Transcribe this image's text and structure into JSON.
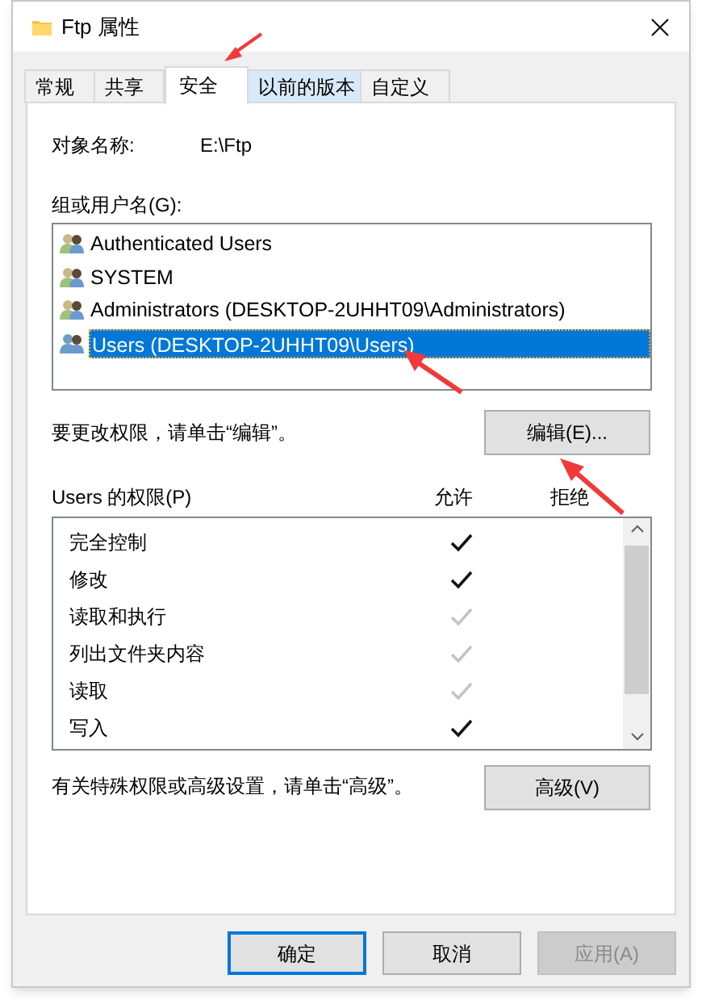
{
  "window": {
    "title": "Ftp 属性"
  },
  "tabs": [
    {
      "label": "常规",
      "selected": false,
      "highlighted": false
    },
    {
      "label": "共享",
      "selected": false,
      "highlighted": false
    },
    {
      "label": "安全",
      "selected": true,
      "highlighted": false
    },
    {
      "label": "以前的版本",
      "selected": false,
      "highlighted": true
    },
    {
      "label": "自定义",
      "selected": false,
      "highlighted": false
    }
  ],
  "object_name": {
    "label": "对象名称:",
    "value": "E:\\Ftp"
  },
  "groups": {
    "label": "组或用户名(G):",
    "items": [
      {
        "name": "Authenticated Users",
        "selected": false
      },
      {
        "name": "SYSTEM",
        "selected": false
      },
      {
        "name": "Administrators (DESKTOP-2UHHT09\\Administrators)",
        "selected": false
      },
      {
        "name": "Users (DESKTOP-2UHHT09\\Users)",
        "selected": true
      }
    ]
  },
  "edit_hint": "要更改权限，请单击“编辑”。",
  "edit_button": "编辑(E)...",
  "permissions": {
    "label": "Users 的权限(P)",
    "allow_heading": "允许",
    "deny_heading": "拒绝",
    "rows": [
      {
        "name": "完全控制",
        "allow": true,
        "inherited": false,
        "deny": false
      },
      {
        "name": "修改",
        "allow": true,
        "inherited": false,
        "deny": false
      },
      {
        "name": "读取和执行",
        "allow": true,
        "inherited": true,
        "deny": false
      },
      {
        "name": "列出文件夹内容",
        "allow": true,
        "inherited": true,
        "deny": false
      },
      {
        "name": "读取",
        "allow": true,
        "inherited": true,
        "deny": false
      },
      {
        "name": "写入",
        "allow": true,
        "inherited": false,
        "deny": false
      }
    ]
  },
  "advanced_hint": "有关特殊权限或高级设置，请单击“高级”。",
  "advanced_button": "高级(V)",
  "buttons": [
    {
      "label": "确定",
      "default": true,
      "disabled": false
    },
    {
      "label": "取消",
      "default": false,
      "disabled": false
    },
    {
      "label": "应用(A)",
      "default": false,
      "disabled": true
    }
  ]
}
